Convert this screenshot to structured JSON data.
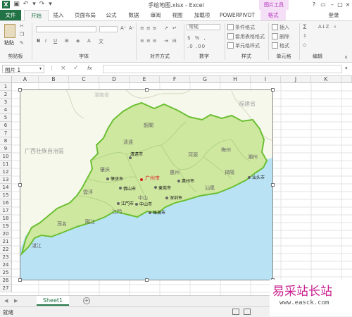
{
  "titlebar": {
    "title": "手绘地图.xlsx - Excel",
    "context_group": "图片工具",
    "app_icon": "X"
  },
  "tabs": [
    {
      "label": "文件"
    },
    {
      "label": "开始"
    },
    {
      "label": "插入"
    },
    {
      "label": "页面布局"
    },
    {
      "label": "公式"
    },
    {
      "label": "数据"
    },
    {
      "label": "审阅"
    },
    {
      "label": "视图"
    },
    {
      "label": "加载项"
    },
    {
      "label": "POWERPIVOT"
    },
    {
      "label": "格式"
    }
  ],
  "account": {
    "login_label": "登录"
  },
  "ribbon": {
    "paste_label": "粘贴",
    "number_format": "常规",
    "conditional_format": "条件格式",
    "table_format": "套用表格格式",
    "cell_style": "单元格样式",
    "insert": "插入",
    "delete": "删除",
    "format": "格式",
    "groups": [
      {
        "label": "剪贴板"
      },
      {
        "label": "字体"
      },
      {
        "label": "对齐方式"
      },
      {
        "label": "数字"
      },
      {
        "label": "样式"
      },
      {
        "label": "单元格"
      },
      {
        "label": "编辑"
      }
    ]
  },
  "formula_bar": {
    "name_box": "图片 1",
    "fx_label": "fx",
    "value": ""
  },
  "columns": [
    "A",
    "B",
    "C",
    "D",
    "E",
    "F",
    "G",
    "H",
    "I",
    "J",
    "K"
  ],
  "rows": [
    "1",
    "2",
    "3",
    "4",
    "5",
    "6",
    "7",
    "8",
    "9",
    "10",
    "11",
    "12",
    "13",
    "14",
    "15",
    "16",
    "17",
    "18",
    "19",
    "20",
    "21",
    "22",
    "23",
    "24",
    "25",
    "26",
    "27"
  ],
  "map": {
    "regions": [
      "湖南省",
      "福建省",
      "广西壮族自治區",
      "韶關",
      "清遠",
      "河源",
      "梅州",
      "潮州",
      "肇庆",
      "揭陽",
      "惠州",
      "汕尾",
      "雲浮",
      "茂名",
      "江門",
      "陽江",
      "湛江",
      "中山"
    ],
    "cities": [
      {
        "name": "清遠市",
        "highlight": false
      },
      {
        "name": "广州市",
        "highlight": true
      },
      {
        "name": "肇庆市",
        "highlight": false
      },
      {
        "name": "佛山市",
        "highlight": false
      },
      {
        "name": "東莞市",
        "highlight": false
      },
      {
        "name": "惠州市",
        "highlight": false
      },
      {
        "name": "深圳市",
        "highlight": false
      },
      {
        "name": "江門市",
        "highlight": false
      },
      {
        "name": "中山市",
        "highlight": false
      },
      {
        "name": "珠海市",
        "highlight": false
      },
      {
        "name": "汕头市",
        "highlight": false
      }
    ],
    "colors": {
      "land": "#cfe8a0",
      "sea": "#b9e3f5",
      "border": "#6bbf33",
      "highlight": "#d51f1f"
    }
  },
  "sheet_tabs": [
    {
      "label": "Sheet1"
    }
  ],
  "status": {
    "ready": "就绪"
  },
  "watermark": {
    "text": "易采站长站",
    "url": "www.easck.com"
  }
}
